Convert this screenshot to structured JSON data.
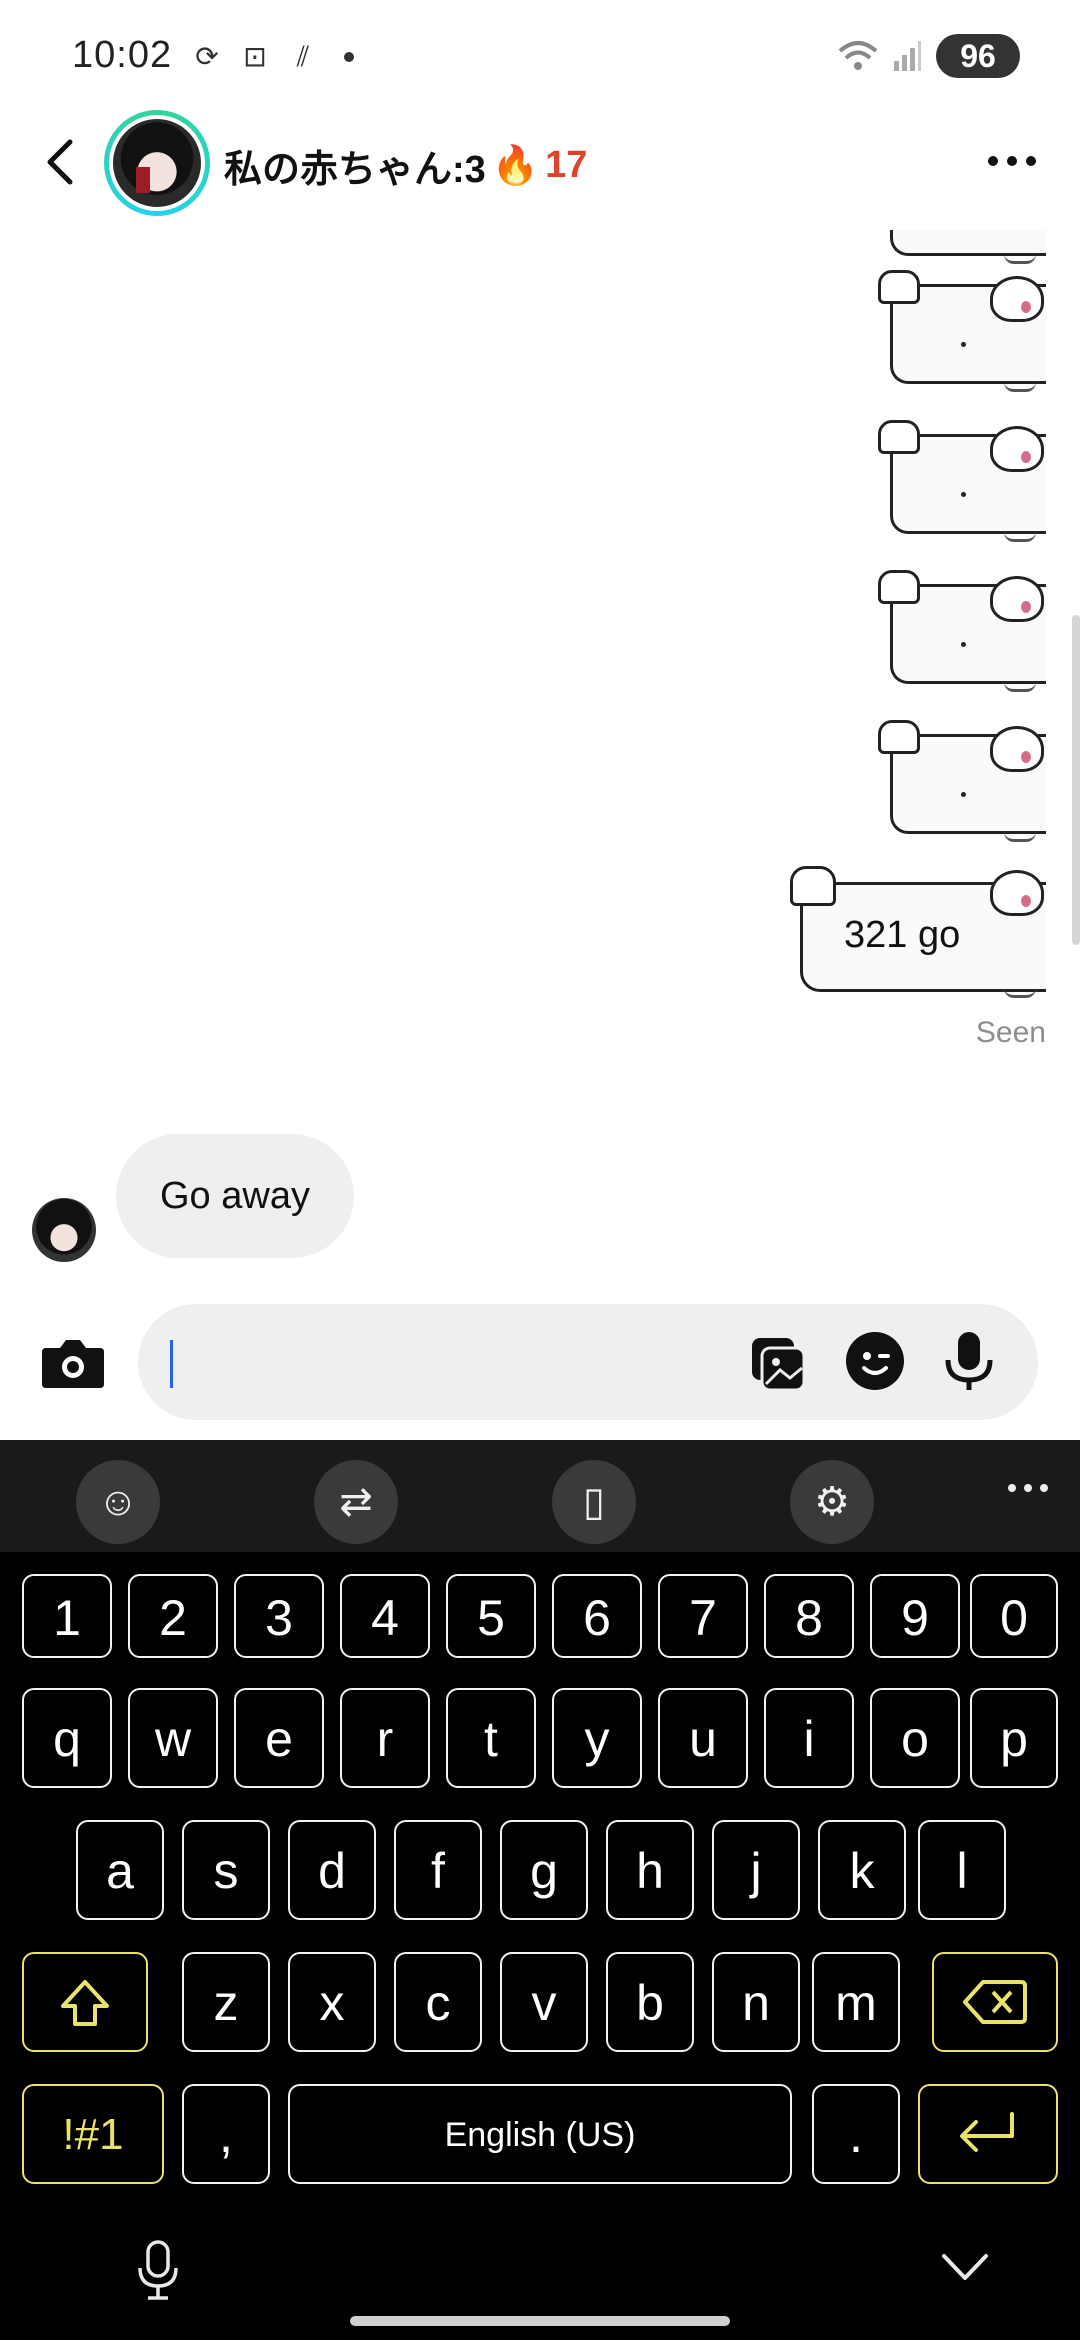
{
  "status_bar": {
    "time": "10:02",
    "battery": "96"
  },
  "header": {
    "title": "私の赤ちゃん:3",
    "streak_emoji": "🔥",
    "streak_count": "17"
  },
  "messages": {
    "sticker_text": "321 go",
    "seen_label": "Seen",
    "incoming_text": "Go away"
  },
  "composer": {
    "value": "",
    "placeholder": ""
  },
  "keyboard": {
    "row_numbers": [
      "1",
      "2",
      "3",
      "4",
      "5",
      "6",
      "7",
      "8",
      "9",
      "0"
    ],
    "row_top": [
      "q",
      "w",
      "e",
      "r",
      "t",
      "y",
      "u",
      "i",
      "o",
      "p"
    ],
    "row_middle": [
      "a",
      "s",
      "d",
      "f",
      "g",
      "h",
      "j",
      "k",
      "l"
    ],
    "row_bottom": [
      "z",
      "x",
      "c",
      "v",
      "b",
      "n",
      "m"
    ],
    "symbols_key": "!#1",
    "comma_key": ",",
    "space_key": "English (US)",
    "period_key": ".",
    "accent_color": "#e9e36a"
  }
}
